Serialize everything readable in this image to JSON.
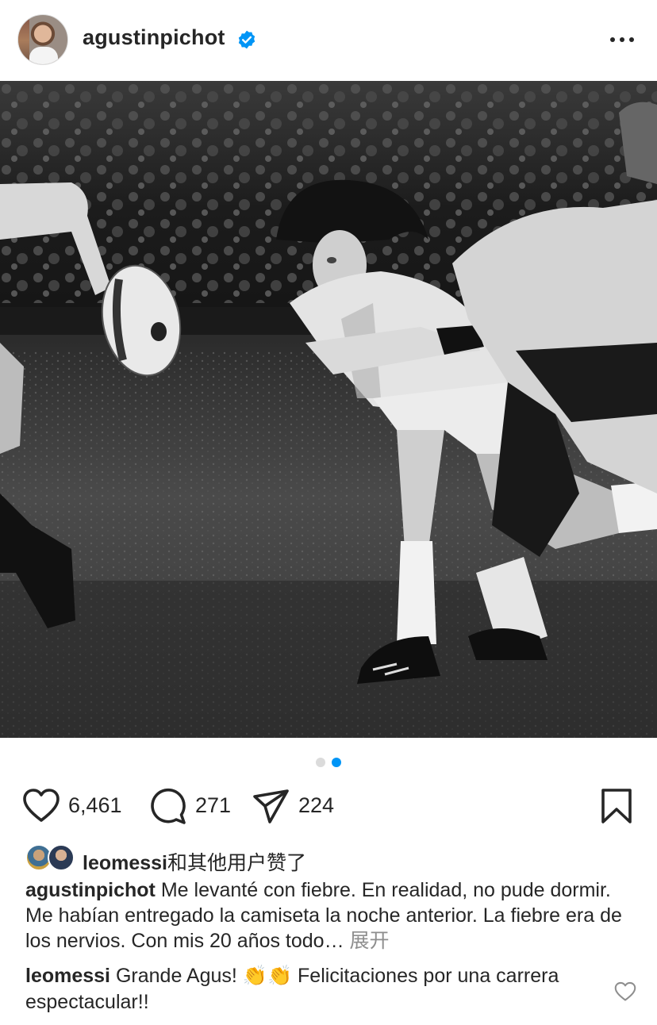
{
  "post": {
    "author": {
      "username": "agustinpichot",
      "verified": true
    }
  },
  "carousel": {
    "total": 2,
    "active_index": 1,
    "active_color": "#0095f6",
    "inactive_color": "#dbdbdb"
  },
  "actions": {
    "likes": "6,461",
    "comments": "271",
    "shares": "224",
    "icons": [
      "heart-icon",
      "comment-icon",
      "share-icon",
      "bookmark-icon"
    ]
  },
  "liked_by": {
    "username": "leomessi",
    "suffix": "和其他用户赞了"
  },
  "caption": {
    "username": "agustinpichot",
    "text": "Me levanté con fiebre. En realidad, no pude dormir. Me habían entregado la camiseta la noche anterior. La fiebre era de los nervios. Con mis 20 años todo…",
    "more": "展开"
  },
  "top_comment": {
    "username": "leomessi",
    "text_before": "Grande Agus!",
    "emoji": "👏👏",
    "text_after": "Felicitaciones por una carrera espectacular!!"
  },
  "colors": {
    "text": "#262626",
    "muted": "#8e8e8e",
    "verified": "#0095f6"
  }
}
